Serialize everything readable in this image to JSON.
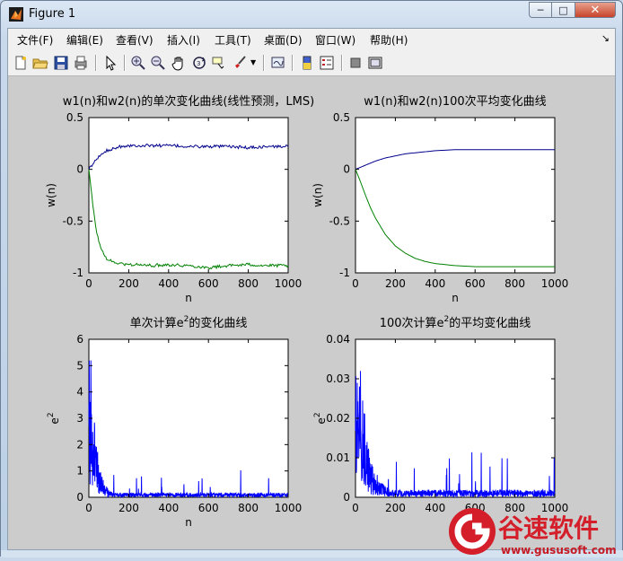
{
  "window": {
    "title": "Figure 1"
  },
  "menu": [
    "文件(F)",
    "编辑(E)",
    "查看(V)",
    "插入(I)",
    "工具(T)",
    "桌面(D)",
    "窗口(W)",
    "帮助(H)"
  ],
  "toolbar": {
    "icons": [
      "new-figure-icon",
      "open-file-icon",
      "save-icon",
      "print-icon",
      "pointer-icon",
      "zoom-in-icon",
      "zoom-out-icon",
      "pan-hand-icon",
      "rotate-3d-icon",
      "data-cursor-icon",
      "brush-icon",
      "brush-dropdown-icon",
      "link-plot-icon",
      "colorbar-icon",
      "legend-icon",
      "hide-plot-tools-icon",
      "show-plot-tools-icon"
    ]
  },
  "watermark": {
    "brand": "谷速软件",
    "url": "www.gususoft.com"
  },
  "colors": {
    "series_blue": "#0000ff",
    "series_darkblue": "#00008b",
    "series_green": "#008000"
  },
  "chart_data": [
    {
      "type": "line",
      "title": "w1(n)和w2(n)的单次变化曲线(线性预测，LMS)",
      "xlabel": "n",
      "ylabel": "w(n)",
      "xlim": [
        0,
        1000
      ],
      "ylim": [
        -1,
        0.5
      ],
      "xticks": [
        "0",
        "200",
        "400",
        "600",
        "800",
        "1000"
      ],
      "yticks": [
        "-1",
        "-0.5",
        "0",
        "0.5"
      ],
      "series": [
        {
          "color": "#00008b",
          "x": [
            0,
            20,
            40,
            60,
            80,
            100,
            150,
            200,
            250,
            300,
            400,
            500,
            600,
            700,
            800,
            900,
            1000
          ],
          "y": [
            0,
            0.05,
            0.1,
            0.14,
            0.17,
            0.19,
            0.22,
            0.23,
            0.23,
            0.23,
            0.23,
            0.22,
            0.22,
            0.22,
            0.21,
            0.22,
            0.22
          ]
        },
        {
          "color": "#008000",
          "x": [
            0,
            20,
            40,
            60,
            80,
            100,
            150,
            200,
            250,
            300,
            400,
            500,
            600,
            700,
            800,
            900,
            1000
          ],
          "y": [
            0,
            -0.35,
            -0.62,
            -0.76,
            -0.84,
            -0.88,
            -0.91,
            -0.92,
            -0.92,
            -0.93,
            -0.92,
            -0.93,
            -0.95,
            -0.93,
            -0.92,
            -0.93,
            -0.93
          ]
        }
      ]
    },
    {
      "type": "line",
      "title": "w1(n)和w2(n)100次平均变化曲线",
      "xlabel": "n",
      "ylabel": "w(n)",
      "xlim": [
        0,
        1000
      ],
      "ylim": [
        -1,
        0.5
      ],
      "xticks": [
        "0",
        "200",
        "400",
        "600",
        "800",
        "1000"
      ],
      "yticks": [
        "-1",
        "-0.5",
        "0",
        "0.5"
      ],
      "series": [
        {
          "color": "#00008b",
          "x": [
            0,
            50,
            100,
            150,
            200,
            250,
            300,
            400,
            500,
            600,
            700,
            800,
            900,
            1000
          ],
          "y": [
            0,
            0.04,
            0.08,
            0.11,
            0.13,
            0.15,
            0.16,
            0.18,
            0.19,
            0.19,
            0.19,
            0.19,
            0.19,
            0.19
          ]
        },
        {
          "color": "#008000",
          "x": [
            0,
            25,
            50,
            75,
            100,
            150,
            200,
            250,
            300,
            350,
            400,
            450,
            500,
            600,
            700,
            800,
            900,
            1000
          ],
          "y": [
            0,
            -0.12,
            -0.25,
            -0.37,
            -0.47,
            -0.63,
            -0.74,
            -0.81,
            -0.86,
            -0.89,
            -0.91,
            -0.92,
            -0.93,
            -0.94,
            -0.94,
            -0.94,
            -0.94,
            -0.94
          ]
        }
      ]
    },
    {
      "type": "line",
      "title_prefix": "单次计算e",
      "title_sup": "2",
      "title_suffix": "的变化曲线",
      "xlabel": "n",
      "ylabel_base": "e",
      "ylabel_sup": "2",
      "xlim": [
        0,
        1000
      ],
      "ylim": [
        0,
        6
      ],
      "xticks": [
        "0",
        "200",
        "400",
        "600",
        "800",
        "1000"
      ],
      "yticks": [
        "0",
        "1",
        "2",
        "3",
        "4",
        "5",
        "6"
      ],
      "series": [
        {
          "color": "#0000ff",
          "noise": {
            "peak": 5.2,
            "peak_at": 10,
            "decay": 35,
            "floor": 0.22,
            "spike": 0.9,
            "seed": 7
          }
        }
      ]
    },
    {
      "type": "line",
      "title_prefix": "100次计算e",
      "title_sup": "2",
      "title_suffix": "的平均变化曲线",
      "xlabel": "",
      "ylabel_base": "e",
      "ylabel_sup": "2",
      "xlim": [
        0,
        1000
      ],
      "ylim": [
        0,
        0.04
      ],
      "xticks": [
        "0",
        "200",
        "400",
        "600",
        "800",
        "1000"
      ],
      "yticks": [
        "0",
        "0.01",
        "0.02",
        "0.03",
        "0.04"
      ],
      "series": [
        {
          "color": "#0000ff",
          "noise": {
            "peak": 0.032,
            "peak_at": 25,
            "decay": 60,
            "floor": 0.0025,
            "spike": 0.011,
            "seed": 13
          }
        }
      ]
    }
  ]
}
